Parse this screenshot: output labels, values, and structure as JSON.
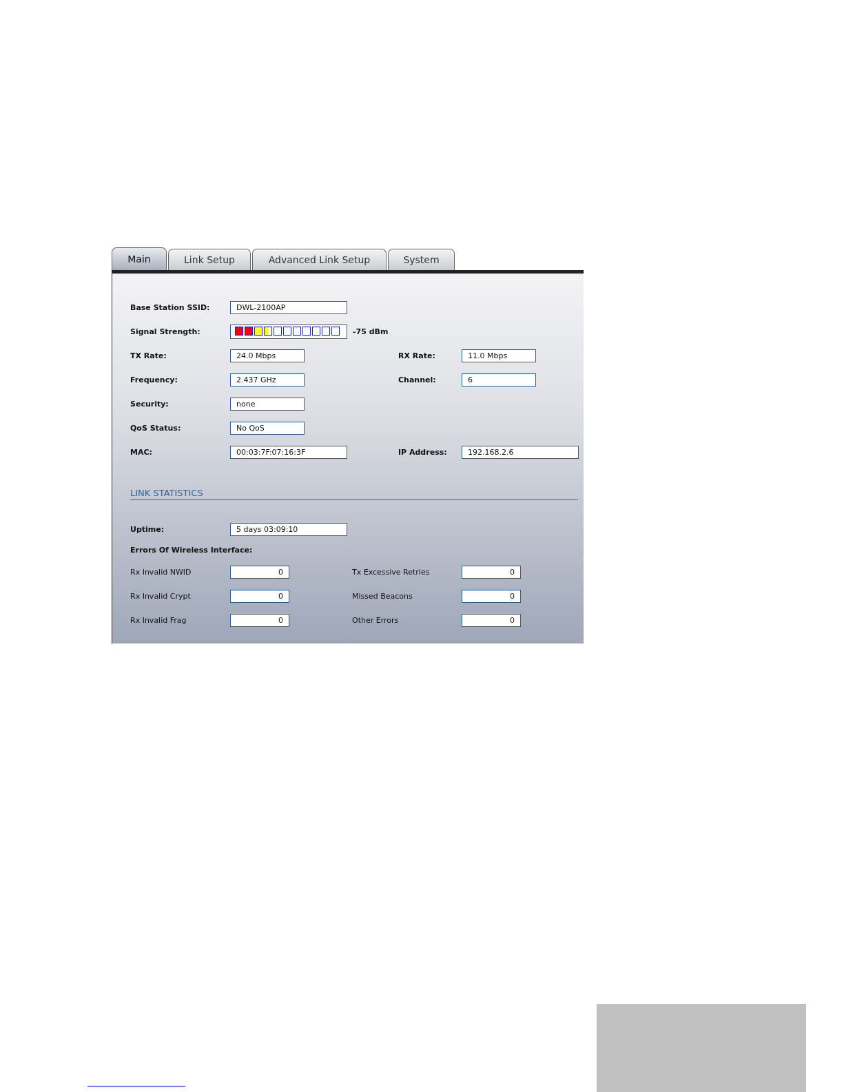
{
  "tabs": [
    {
      "label": "Main",
      "selected": true
    },
    {
      "label": "Link Setup",
      "selected": false
    },
    {
      "label": "Advanced Link Setup",
      "selected": false
    },
    {
      "label": "System",
      "selected": false
    }
  ],
  "status": [
    {
      "kind": "field",
      "label": "Base Station SSID:",
      "value": "DWL-2100AP"
    },
    {
      "kind": "signal",
      "label": "Signal Strength:",
      "level": 0.32,
      "reading": "-75 dBm"
    },
    {
      "kind": "field",
      "label": "TX Rate:",
      "value": "24.0 Mbps",
      "right": {
        "label": "RX Rate:",
        "value": "11.0 Mbps"
      }
    },
    {
      "kind": "field",
      "label": "Frequency:",
      "value": "2.437 GHz",
      "right": {
        "label": "Channel:",
        "value": "6"
      }
    },
    {
      "kind": "field",
      "label": "Security:",
      "value": "none"
    },
    {
      "kind": "field",
      "label": "QoS Status:",
      "value": "No QoS"
    },
    {
      "kind": "field",
      "label": "MAC:",
      "value": "00:03:7F:07:16:3F",
      "right": {
        "label": "IP Address:",
        "value": "192.168.2.6"
      }
    }
  ],
  "link_statistics": {
    "title": "LINK STATISTICS",
    "uptime": {
      "label": "Uptime:",
      "value": "5 days 03:09:10"
    },
    "errors_title": "Errors Of Wireless Interface:",
    "errors": [
      {
        "left": {
          "label": "Rx Invalid NWID",
          "value": "0"
        },
        "right": {
          "label": "Tx Excessive Retries",
          "value": "0"
        }
      },
      {
        "left": {
          "label": "Rx Invalid Crypt",
          "value": "0"
        },
        "right": {
          "label": "Missed Beacons",
          "value": "0"
        }
      },
      {
        "left": {
          "label": "Rx Invalid Frag",
          "value": "0"
        },
        "right": {
          "label": "Other Errors",
          "value": "0"
        }
      }
    ]
  }
}
